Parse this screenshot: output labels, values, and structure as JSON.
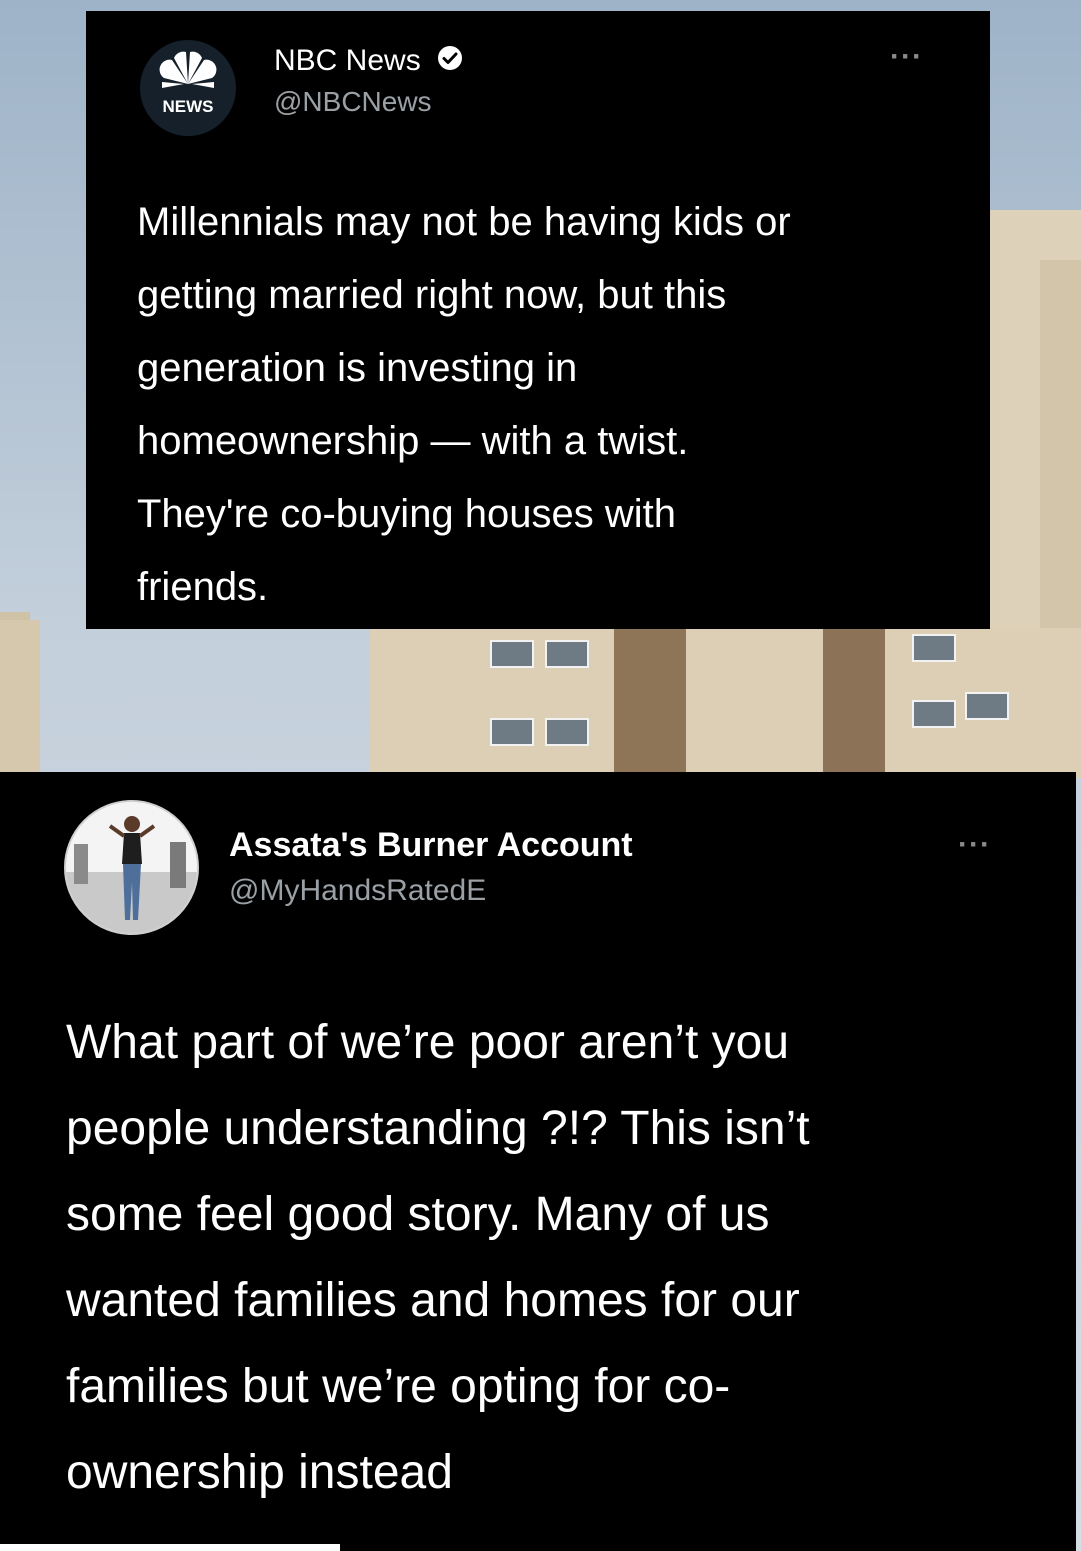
{
  "tweets": [
    {
      "display_name": "NBC News",
      "handle": "@NBCNews",
      "avatar_label": "NEWS",
      "verified": true,
      "more_icon": "ellipsis-icon",
      "text": "Millennials may not be having kids or\ngetting married right now, but this\ngeneration is investing in\nhomeownership — with a twist.\nThey're co-buying houses with\nfriends."
    },
    {
      "display_name": "Assata's Burner Account",
      "handle": "@MyHandsRatedE",
      "verified": false,
      "more_icon": "ellipsis-icon",
      "text": "What part of we’re poor aren’t you\npeople understanding ?!? This isn’t\nsome feel good story. Many of us\nwanted families and homes for our\nfamilies but we’re opting for co-\nownership instead"
    }
  ],
  "colors": {
    "tweet_background": "#000000",
    "verified_badge": "#1d9bf0",
    "handle_text": "#9aa0a6"
  }
}
